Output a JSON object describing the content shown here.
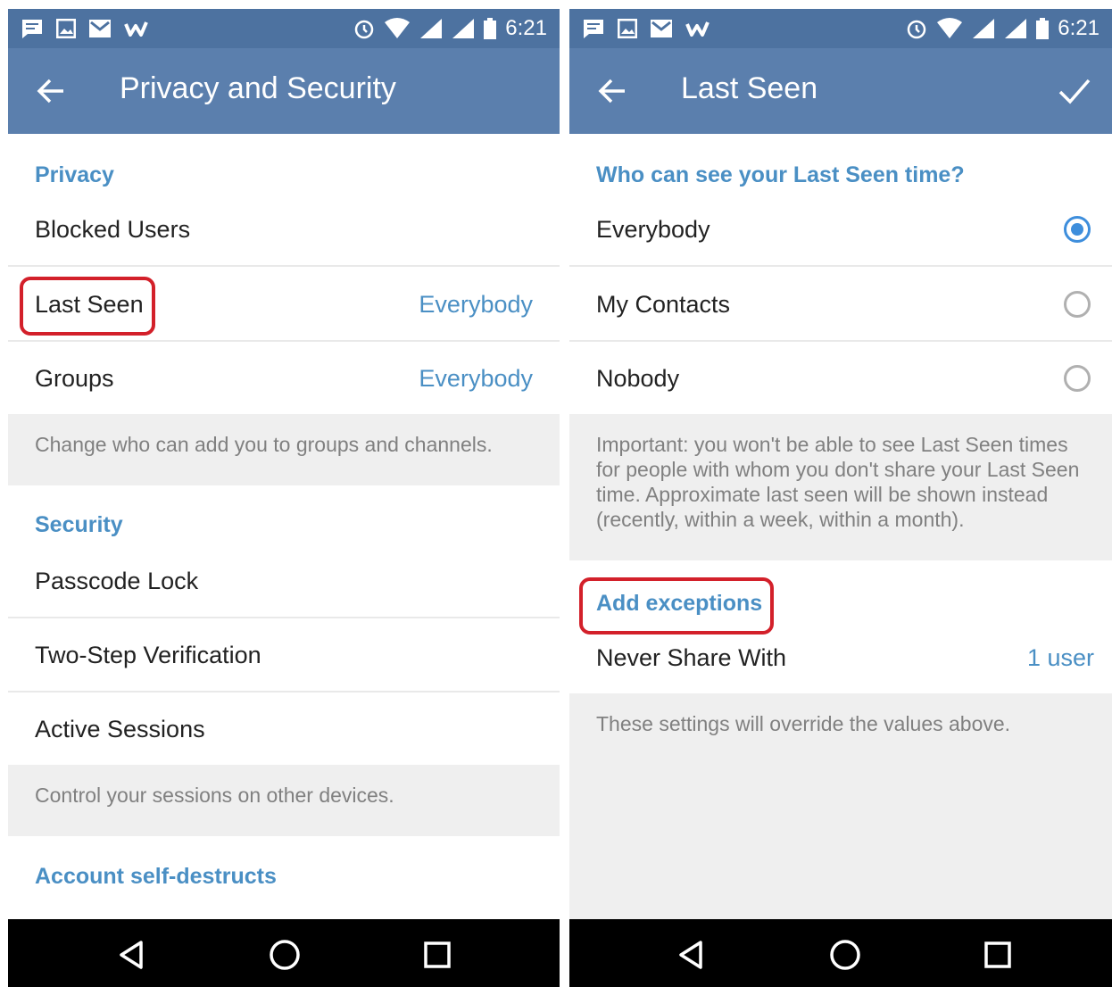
{
  "status_bar": {
    "time": "6:21"
  },
  "left": {
    "title": "Privacy and Security",
    "privacy": {
      "header": "Privacy",
      "items": [
        {
          "label": "Blocked Users",
          "value": ""
        },
        {
          "label": "Last Seen",
          "value": "Everybody"
        },
        {
          "label": "Groups",
          "value": "Everybody"
        }
      ],
      "hint": "Change who can add you to groups and channels."
    },
    "security": {
      "header": "Security",
      "items": [
        {
          "label": "Passcode Lock"
        },
        {
          "label": "Two-Step Verification"
        },
        {
          "label": "Active Sessions"
        }
      ],
      "hint": "Control your sessions on other devices."
    },
    "account": {
      "header": "Account self-destructs"
    }
  },
  "right": {
    "title": "Last Seen",
    "question": "Who can see your Last Seen time?",
    "options": [
      {
        "label": "Everybody",
        "selected": true
      },
      {
        "label": "My Contacts",
        "selected": false
      },
      {
        "label": "Nobody",
        "selected": false
      }
    ],
    "important": "Important: you won't be able to see Last Seen times for people with whom you don't share your Last Seen time. Approximate last seen will be shown instead (recently, within a week, within a month).",
    "exceptions": {
      "header": "Add exceptions",
      "never_share_label": "Never Share With",
      "never_share_value": "1 user",
      "hint": "These settings will override the values above."
    }
  },
  "colors": {
    "status_bar": "#4d72a0",
    "app_bar": "#5b7fad",
    "accent": "#4a8fc4",
    "radio_selected": "#3e8edc",
    "highlight": "#d3202a"
  },
  "icons": [
    "message-icon",
    "image-icon",
    "mail-icon",
    "w-app-icon",
    "alarm-icon",
    "wifi-icon",
    "signal-icon",
    "battery-icon",
    "back-arrow-icon",
    "check-icon",
    "nav-back-icon",
    "nav-home-icon",
    "nav-recents-icon"
  ]
}
